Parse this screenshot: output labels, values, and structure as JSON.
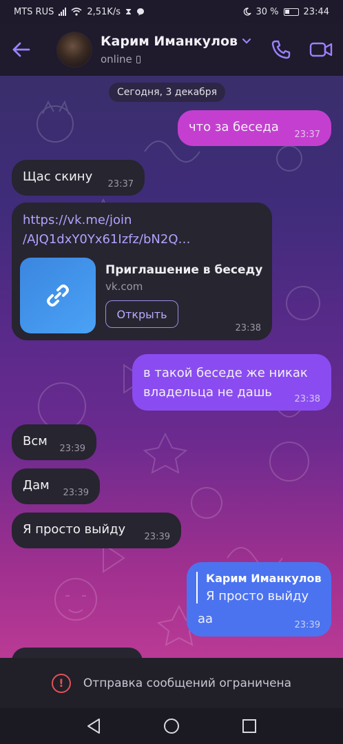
{
  "status_bar": {
    "carrier": "MTS RUS",
    "speed": "2,51K/s",
    "battery_text": "30 %",
    "battery_level": 0.3,
    "time": "23:44"
  },
  "header": {
    "contact_name": "Карим Иманкулов",
    "presence": "online",
    "icons": [
      "back-arrow-icon",
      "chevron-down-icon",
      "phone-icon",
      "video-call-icon"
    ]
  },
  "chat": {
    "date_chip": "Сегодня, 3 декабря",
    "messages": [
      {
        "dir": "out",
        "text": "что за беседа",
        "time": "23:37"
      },
      {
        "dir": "in",
        "text": "Щас скину",
        "time": "23:37"
      },
      {
        "dir": "in",
        "link_line1": "https://vk.me/join",
        "link_line2": "/AJQ1dxY0Yx61Izfz/bN2Q…",
        "card_title": "Приглашение в беседу",
        "card_domain": "vk.com",
        "card_button": "Открыть",
        "time": "23:38"
      },
      {
        "dir": "out",
        "line1": "в такой беседе же никак",
        "line2": "владельца не дашь",
        "time": "23:38"
      },
      {
        "dir": "in",
        "text": "Всм",
        "time": "23:39"
      },
      {
        "dir": "in",
        "text": "Дам",
        "time": "23:39"
      },
      {
        "dir": "in",
        "text": "Я просто выйду",
        "time": "23:39"
      },
      {
        "dir": "out",
        "quote_author": "Карим Иманкулов",
        "quote_text": "Я просто выйду",
        "text": "аа",
        "time": "23:39"
      }
    ]
  },
  "composer": {
    "notice": "Отправка сообщений ограничена"
  },
  "colors": {
    "accent": "#8f7cf2",
    "out_bubble_pink": "#c43fd0",
    "out_bubble_violet": "#8a4cf0",
    "out_bubble_blue": "#4b73f0",
    "in_bubble": "#272530",
    "warning": "#e55157"
  }
}
